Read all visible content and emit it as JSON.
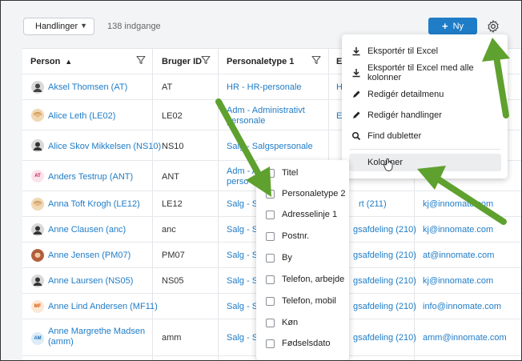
{
  "toolbar": {
    "actions_label": "Handlinger",
    "count_label": "138 indgange",
    "new_label": "Ny"
  },
  "table": {
    "headers": [
      "Person",
      "Bruger ID",
      "Personaletype 1",
      "E"
    ],
    "rows": [
      {
        "name": "Aksel Thomsen (AT)",
        "avatar": "man",
        "id": "AT",
        "type": "HR - HR-personale",
        "c4": "H",
        "email": ""
      },
      {
        "name": "Alice Leth (LE02)",
        "avatar": "woman",
        "id": "LE02",
        "type": "Adm - Administrativt personale",
        "c4": "El",
        "email": ""
      },
      {
        "name": "Alice Skov Mikkelsen (NS10)",
        "avatar": "man",
        "id": "NS10",
        "type": "Salg - Salgspersonale",
        "c4": "",
        "email": ""
      },
      {
        "name": "Anders Testrup (ANT)",
        "avatar": "AT",
        "id": "ANT",
        "type": "Adm - A",
        "type2": "perso",
        "c4": "",
        "email": ""
      },
      {
        "name": "Anna Toft Krogh (LE12)",
        "avatar": "woman",
        "id": "LE12",
        "type": "Salg - Sa",
        "c4": "rt (211)",
        "email": "kj@innomate.com"
      },
      {
        "name": "Anne Clausen (anc)",
        "avatar": "man",
        "id": "anc",
        "type": "Salg - Sa",
        "c4": "gsafdeling (210)",
        "email": "kj@innomate.com"
      },
      {
        "name": "Anne Jensen (PM07)",
        "avatar": "woman",
        "id": "PM07",
        "type": "Salg - Sa",
        "c4": "gsafdeling (210)",
        "email": "at@innomate.com"
      },
      {
        "name": "Anne Laursen (NS05)",
        "avatar": "man",
        "id": "NS05",
        "type": "Salg - Sa",
        "c4": "gsafdeling (210)",
        "email": "kj@innomate.com"
      },
      {
        "name": "Anne Lind Andersen (MF11)",
        "avatar": "MF",
        "id": "",
        "type": "Salg - Sa",
        "c4": "gsafdeling (210)",
        "email": "info@innomate.com"
      },
      {
        "name": "Anne Margrethe Madsen (amm)",
        "avatar": "AM",
        "id": "amm",
        "type": "Salg - Sa",
        "c4": "gsafdeling (210)",
        "email": "amm@innomate.com"
      }
    ]
  },
  "menu": {
    "items": [
      {
        "label": "Eksportér til Excel",
        "icon": "download-icon"
      },
      {
        "label": "Eksportér til Excel med alle kolonner",
        "icon": "download-icon"
      },
      {
        "label": "Redigér detailmenu",
        "icon": "pencil-icon"
      },
      {
        "label": "Redigér handlinger",
        "icon": "pencil-icon"
      },
      {
        "label": "Find dubletter",
        "icon": "search-icon"
      },
      {
        "label": "Kolonner",
        "icon": ""
      }
    ]
  },
  "columns_submenu": {
    "items": [
      "Titel",
      "Personaletype 2",
      "Adresselinje 1",
      "Postnr.",
      "By",
      "Telefon, arbejde",
      "Telefon, mobil",
      "Køn",
      "Fødselsdato"
    ]
  },
  "colors": {
    "accent": "#1f7cc7",
    "arrow": "#5ea12e"
  }
}
